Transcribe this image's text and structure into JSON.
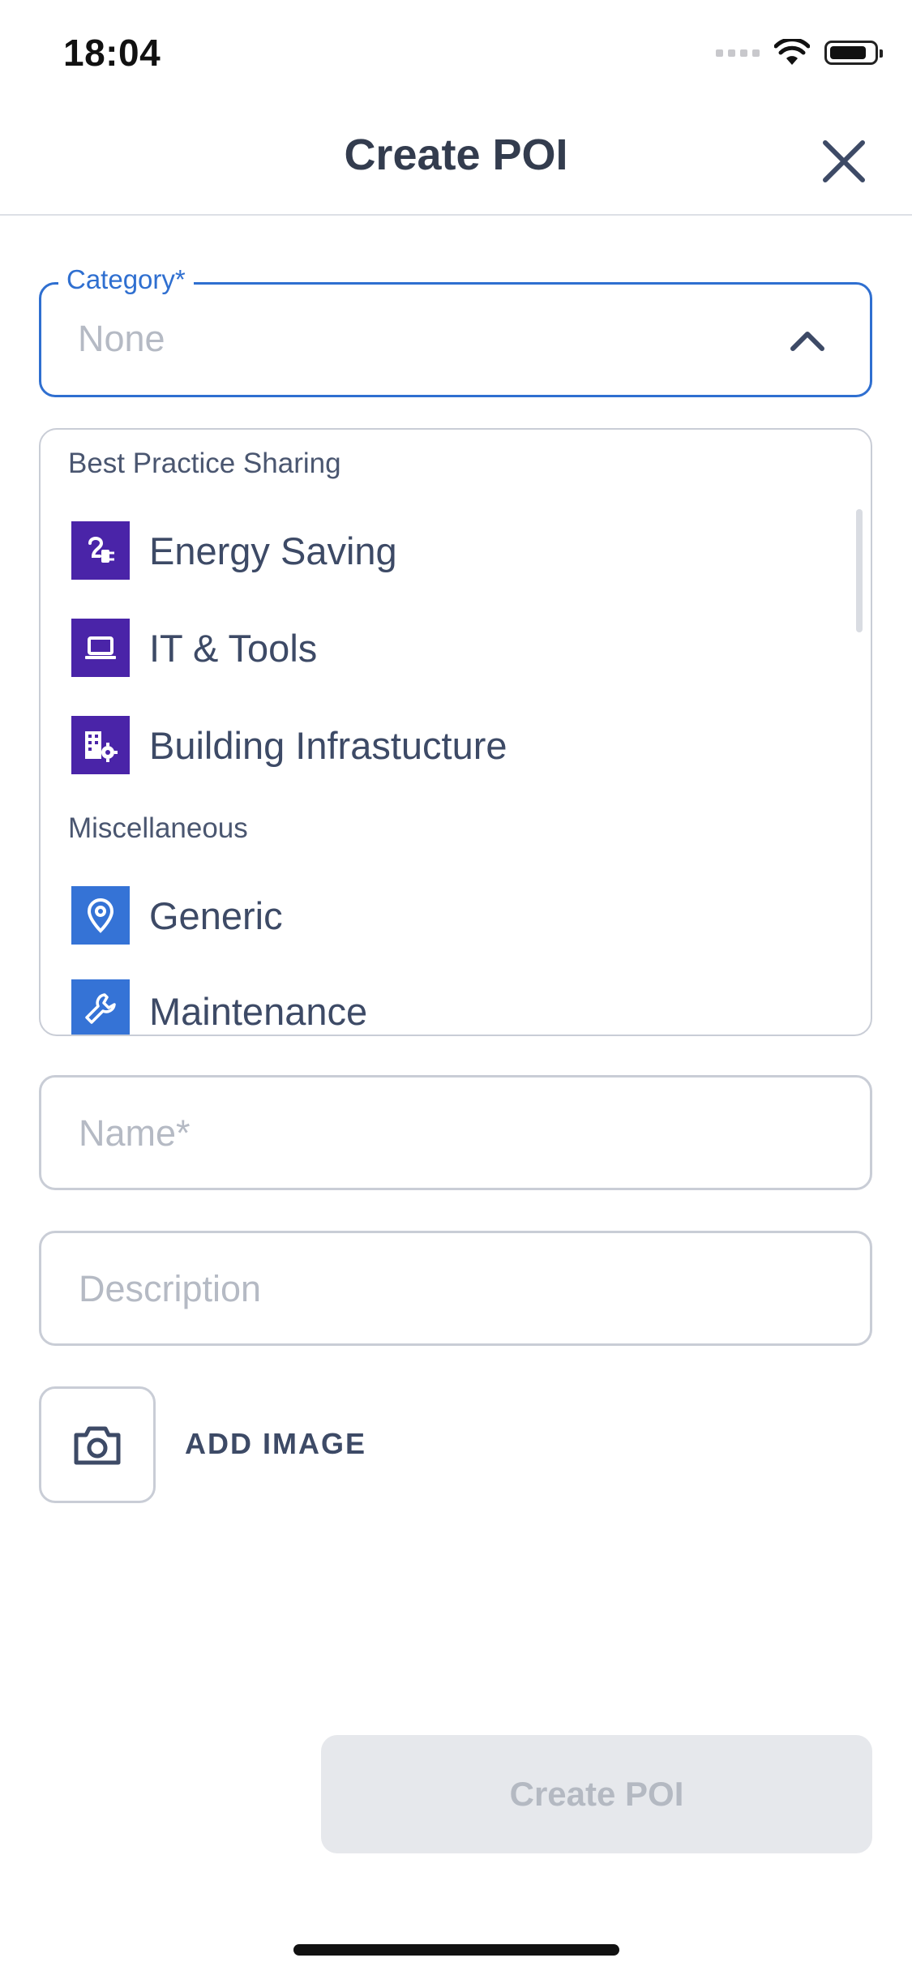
{
  "status_bar": {
    "time": "18:04"
  },
  "header": {
    "title": "Create POI"
  },
  "category": {
    "label": "Category*",
    "value": "None"
  },
  "dropdown": {
    "groups": [
      {
        "label": "Best Practice Sharing",
        "items": [
          {
            "label": "Energy Saving",
            "icon": "plug-icon",
            "color": "#4a24a8"
          },
          {
            "label": "IT & Tools",
            "icon": "laptop-icon",
            "color": "#4a24a8"
          },
          {
            "label": "Building Infrastucture",
            "icon": "building-gear-icon",
            "color": "#4a24a8"
          }
        ]
      },
      {
        "label": "Miscellaneous",
        "items": [
          {
            "label": "Generic",
            "icon": "location-pin-icon",
            "color": "#3573d6"
          },
          {
            "label": "Maintenance",
            "icon": "wrench-icon",
            "color": "#3573d6"
          }
        ]
      }
    ]
  },
  "form": {
    "name_placeholder": "Name*",
    "description_placeholder": "Description",
    "add_image_label": "ADD IMAGE",
    "submit_label": "Create POI"
  },
  "colors": {
    "accent": "#2f6fd0",
    "category_purple": "#4a24a8",
    "category_blue": "#3573d6",
    "disabled_button": "#e6e8ec"
  }
}
